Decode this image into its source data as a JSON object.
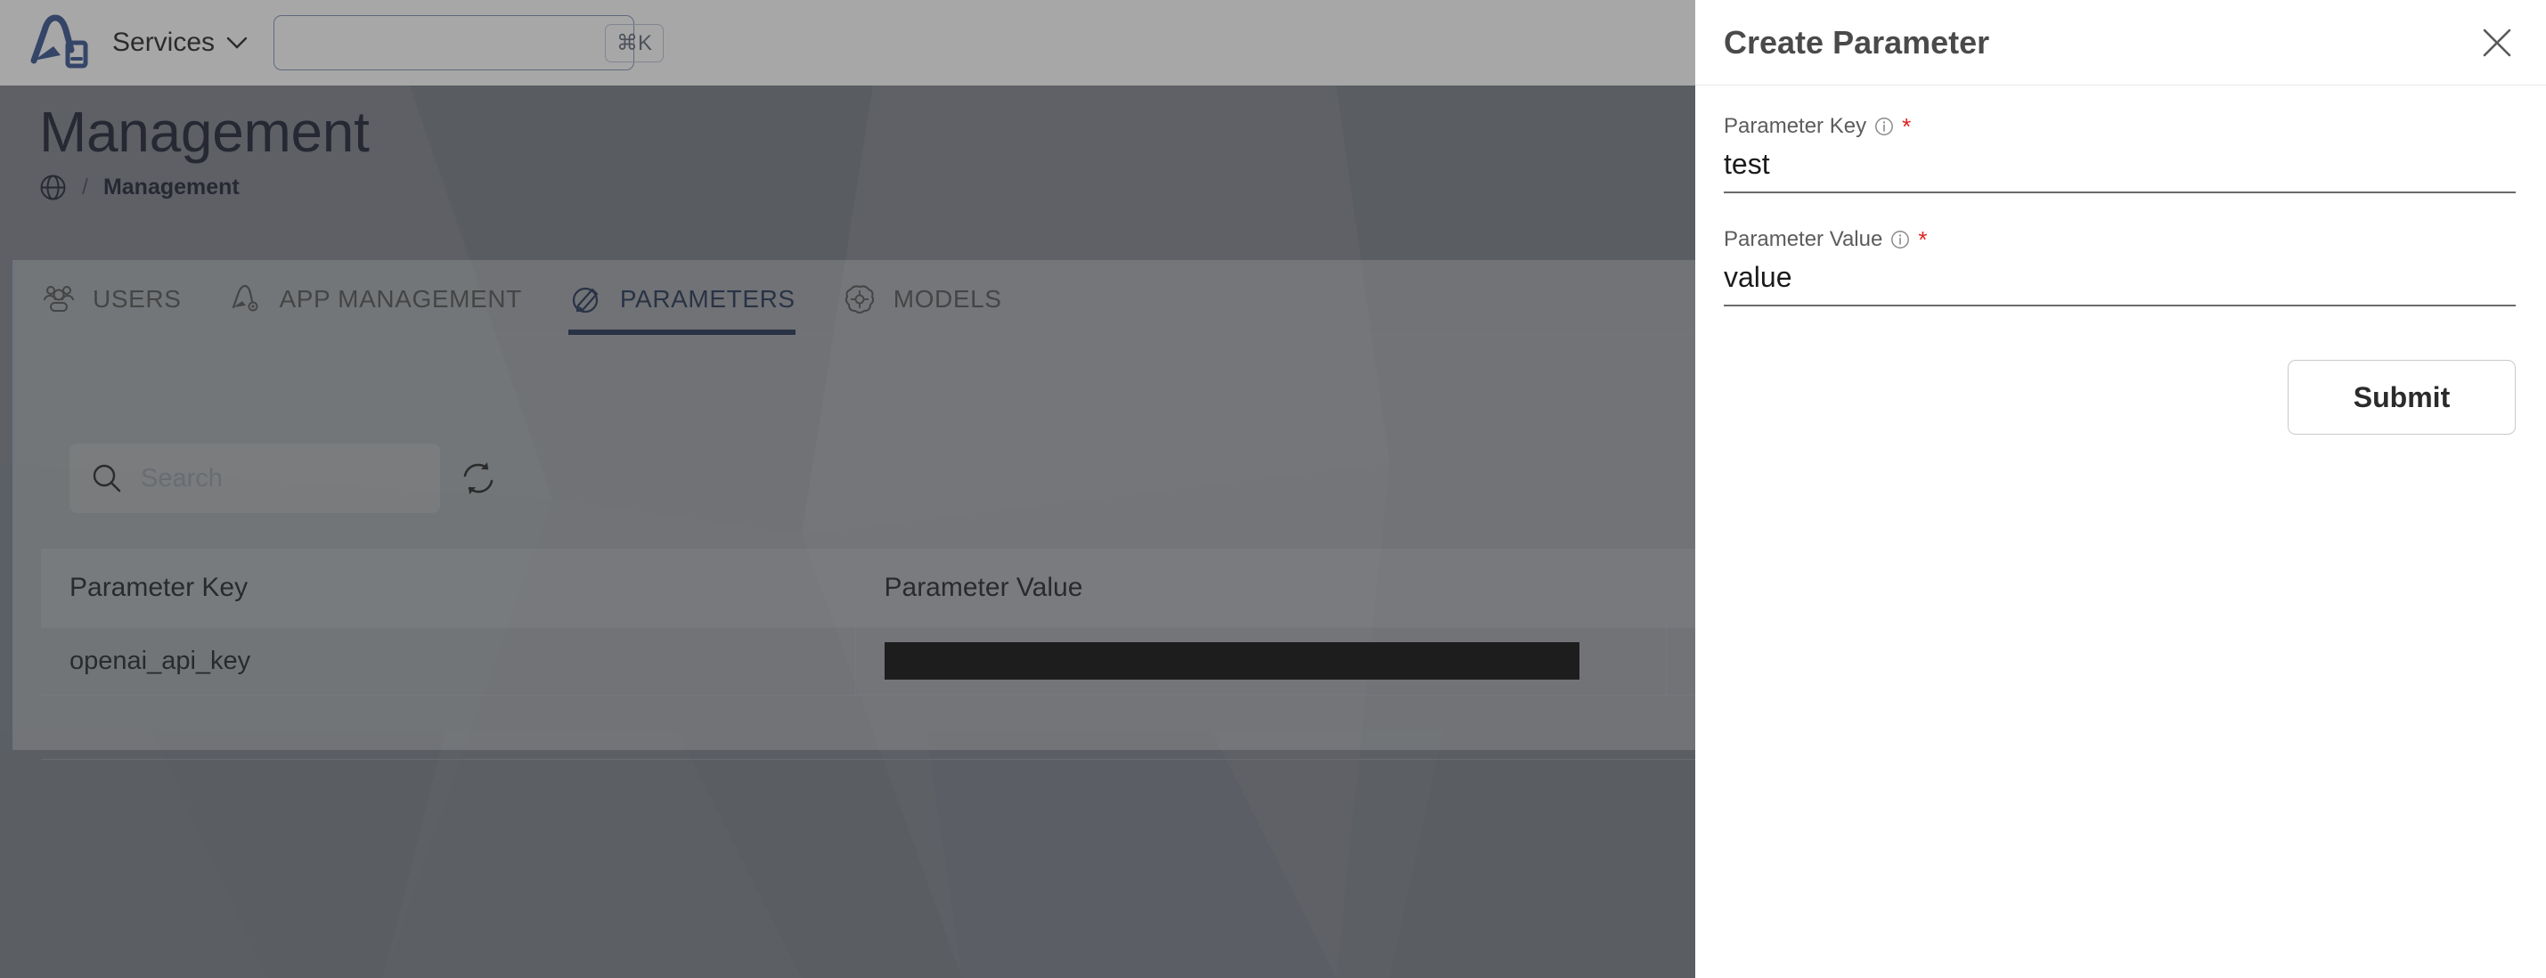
{
  "topbar": {
    "logo_name": "analytics-logo",
    "services_label": "Services",
    "search_placeholder": "",
    "search_value": "",
    "search_shortcut": "⌘K"
  },
  "header": {
    "title": "Management",
    "breadcrumb_separator": "/",
    "breadcrumb_current": "Management"
  },
  "tabs": [
    {
      "id": "users",
      "label": "USERS",
      "icon": "users-icon",
      "active": false
    },
    {
      "id": "app-management",
      "label": "APP MANAGEMENT",
      "icon": "app-management-icon",
      "active": false
    },
    {
      "id": "parameters",
      "label": "PARAMETERS",
      "icon": "parameters-icon",
      "active": true
    },
    {
      "id": "models",
      "label": "MODELS",
      "icon": "models-brain-icon",
      "active": false
    }
  ],
  "toolbar": {
    "search_placeholder": "Search",
    "search_value": "",
    "refresh_label": "refresh-icon"
  },
  "table": {
    "columns": [
      "Parameter Key",
      "Parameter Value",
      ""
    ],
    "rows": [
      {
        "key": "openai_api_key",
        "value": "",
        "value_redacted": true,
        "extra": ""
      }
    ]
  },
  "modal": {
    "title": "Create Parameter",
    "close_label": "close-icon",
    "fields": [
      {
        "label": "Parameter Key",
        "required_marker": "*",
        "value": "test",
        "placeholder": ""
      },
      {
        "label": "Parameter Value",
        "required_marker": "*",
        "value": "value",
        "placeholder": ""
      }
    ],
    "submit_label": "Submit"
  },
  "colors": {
    "accent_navy": "#17294a",
    "brand_blue": "#2b4a8b",
    "required_red": "#e02020",
    "page_bg": "#767b82"
  }
}
